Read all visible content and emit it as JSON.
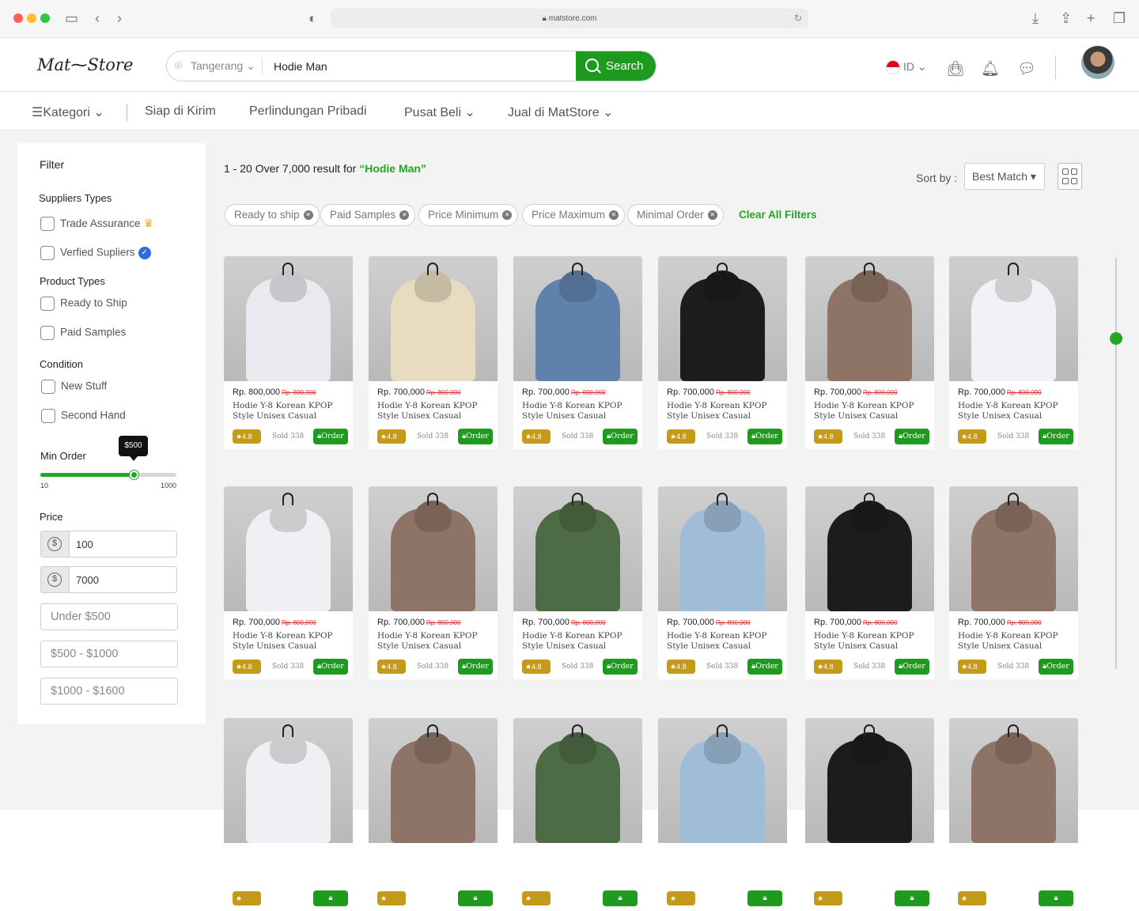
{
  "browser": {
    "url": "matstore.com"
  },
  "header": {
    "logo": "Mat⁓Store",
    "location": "Tangerang",
    "search_value": "Hodie Man",
    "search_button": "Search",
    "language": "ID"
  },
  "nav": {
    "category": "Kategori",
    "items": [
      "Siap di Kirim",
      "Perlindungan Pribadi",
      "Pusat Beli",
      "Jual di MatStore"
    ]
  },
  "filter": {
    "title": "Filter",
    "suppliers_types": {
      "heading": "Suppliers Types",
      "options": [
        "Trade Assurance",
        "Verfied Supliers"
      ]
    },
    "product_types": {
      "heading": "Product Types",
      "options": [
        "Ready to Ship",
        "Paid Samples"
      ]
    },
    "condition": {
      "heading": "Condition",
      "options": [
        "New Stuff",
        "Second Hand"
      ]
    },
    "min_order": {
      "heading": "Min Order",
      "min": "10",
      "max": "1000",
      "tooltip": "$500",
      "level": 0.69
    },
    "price": {
      "heading": "Price",
      "min_value": "100",
      "max_value": "7000",
      "ranges": [
        "Under $500",
        "$500 - $1000",
        "$1000 - $1600"
      ]
    }
  },
  "results": {
    "prefix": "1 - 20 Over 7,000 result for ",
    "query": "“Hodie Man”",
    "sort_label": "Sort by :",
    "sort_value": "Best Match",
    "chips": [
      "Ready to ship",
      "Paid Samples",
      "Price Minimum",
      "Price Maximum",
      "Minimal Order"
    ],
    "clear_all": "Clear All Filters"
  },
  "products": [
    {
      "price": "Rp. 800,000",
      "old_price": "Rp. 800,000",
      "name": "Hodie Y-8 Korean KPOP Style Unisex Casual",
      "rating": "4.8",
      "sold": "Sold 338",
      "order": "Order",
      "color": "#e9e9f0"
    },
    {
      "price": "Rp. 700,000",
      "old_price": "Rp. 800,000",
      "name": "Hodie Y-8 Korean KPOP Style Unisex Casual",
      "rating": "4.8",
      "sold": "Sold 338",
      "order": "Order",
      "color": "#e8dcc0"
    },
    {
      "price": "Rp. 700,000",
      "old_price": "Rp. 800,000",
      "name": "Hodie Y-8 Korean KPOP Style Unisex Casual",
      "rating": "4.8",
      "sold": "Sold 338",
      "order": "Order",
      "color": "#5f82ad"
    },
    {
      "price": "Rp. 700,000",
      "old_price": "Rp. 800,000",
      "name": "Hodie Y-8 Korean KPOP Style Unisex Casual",
      "rating": "4.8",
      "sold": "Sold 338",
      "order": "Order",
      "color": "#1c1c1c"
    },
    {
      "price": "Rp. 700,000",
      "old_price": "Rp. 800,000",
      "name": "Hodie Y-8 Korean KPOP Style Unisex Casual",
      "rating": "4.8",
      "sold": "Sold 338",
      "order": "Order",
      "color": "#8e7466"
    },
    {
      "price": "Rp. 700,000",
      "old_price": "Rp. 800,000",
      "name": "Hodie Y-8 Korean KPOP Style Unisex Casual",
      "rating": "4.8",
      "sold": "Sold 338",
      "order": "Order",
      "color": "#f2f2f6"
    },
    {
      "price": "Rp. 700,000",
      "old_price": "Rp. 800,000",
      "name": "Hodie Y-8 Korean KPOP Style Unisex Casual",
      "rating": "4.8",
      "sold": "Sold 338",
      "order": "Order",
      "color": "#f0f0f4"
    },
    {
      "price": "Rp. 700,000",
      "old_price": "Rp. 800,000",
      "name": "Hodie Y-8 Korean KPOP Style Unisex Casual",
      "rating": "4.8",
      "sold": "Sold 338",
      "order": "Order",
      "color": "#8e7466"
    },
    {
      "price": "Rp. 700,000",
      "old_price": "Rp. 800,000",
      "name": "Hodie Y-8 Korean KPOP Style Unisex Casual",
      "rating": "4.8",
      "sold": "Sold 338",
      "order": "Order",
      "color": "#4d6b45"
    },
    {
      "price": "Rp. 700,000",
      "old_price": "Rp. 800,000",
      "name": "Hodie Y-8 Korean KPOP Style Unisex Casual",
      "rating": "4.8",
      "sold": "Sold 338",
      "order": "Order",
      "color": "#9fbcd8"
    },
    {
      "price": "Rp. 700,000",
      "old_price": "Rp. 800,000",
      "name": "Hodie Y-8 Korean KPOP Style Unisex Casual",
      "rating": "4.8",
      "sold": "Sold 338",
      "order": "Order",
      "color": "#1c1c1c"
    },
    {
      "price": "Rp. 700,000",
      "old_price": "Rp. 800,000",
      "name": "Hodie Y-8 Korean KPOP Style Unisex Casual",
      "rating": "4.8",
      "sold": "Sold 338",
      "order": "Order",
      "color": "#8e7466"
    },
    {
      "price": "",
      "old_price": "",
      "name": "",
      "rating": "",
      "sold": "",
      "order": "",
      "color": "#f0f0f4"
    },
    {
      "price": "",
      "old_price": "",
      "name": "",
      "rating": "",
      "sold": "",
      "order": "",
      "color": "#8e7466"
    },
    {
      "price": "",
      "old_price": "",
      "name": "",
      "rating": "",
      "sold": "",
      "order": "",
      "color": "#4d6b45"
    },
    {
      "price": "",
      "old_price": "",
      "name": "",
      "rating": "",
      "sold": "",
      "order": "",
      "color": "#9fbcd8"
    },
    {
      "price": "",
      "old_price": "",
      "name": "",
      "rating": "",
      "sold": "",
      "order": "",
      "color": "#1c1c1c"
    },
    {
      "price": "",
      "old_price": "",
      "name": "",
      "rating": "",
      "sold": "",
      "order": "",
      "color": "#8e7466"
    }
  ],
  "scroll_position": 0.18
}
